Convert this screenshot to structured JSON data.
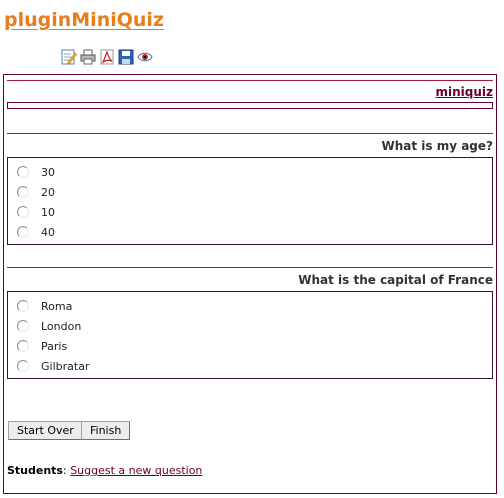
{
  "page": {
    "title": "pluginMiniQuiz"
  },
  "toolbar": {
    "icons": [
      "edit-icon",
      "print-icon",
      "pdf-icon",
      "save-icon",
      "view-icon"
    ]
  },
  "quiz": {
    "box_title": "miniquiz",
    "questions": [
      {
        "text": "What is my age?",
        "choices": [
          "30",
          "20",
          "10",
          "40"
        ]
      },
      {
        "text": "What is the capital of France",
        "choices": [
          "Roma",
          "London",
          "Paris",
          "Gilbratar"
        ]
      }
    ],
    "start_over_label": "Start Over",
    "finish_label": "Finish"
  },
  "footer": {
    "students_label": "Students",
    "suggest_link": "Suggest a new question"
  },
  "colors": {
    "title": "#e87d1e",
    "accent": "#660033",
    "rule": "#a61a3d"
  }
}
